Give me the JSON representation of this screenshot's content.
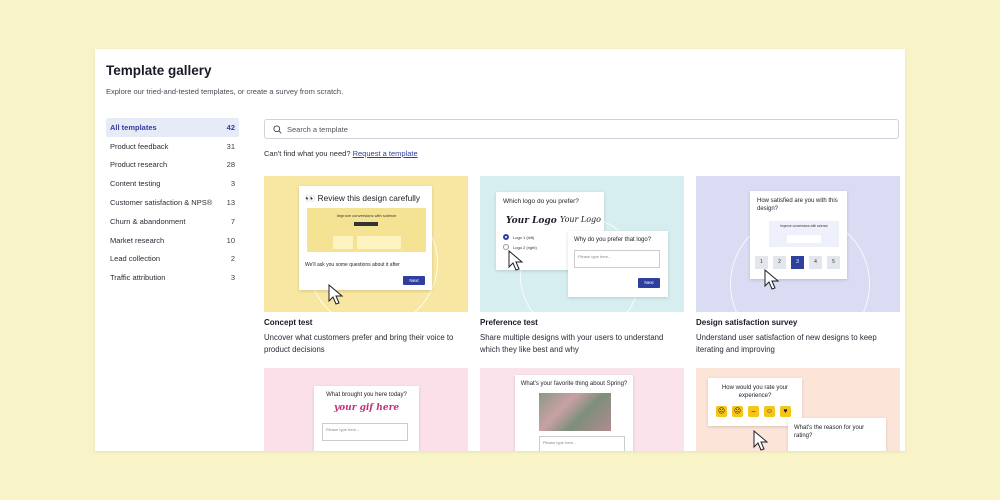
{
  "header": {
    "title": "Template gallery",
    "subtitle": "Explore our tried-and-tested templates, or create a survey from scratch."
  },
  "sidebar": {
    "items": [
      {
        "label": "All templates",
        "count": "42"
      },
      {
        "label": "Product feedback",
        "count": "31"
      },
      {
        "label": "Product research",
        "count": "28"
      },
      {
        "label": "Content testing",
        "count": "3"
      },
      {
        "label": "Customer satisfaction & NPS®",
        "count": "13"
      },
      {
        "label": "Churn & abandonment",
        "count": "7"
      },
      {
        "label": "Market research",
        "count": "10"
      },
      {
        "label": "Lead collection",
        "count": "2"
      },
      {
        "label": "Traffic attribution",
        "count": "3"
      }
    ]
  },
  "search": {
    "placeholder": "Search a template"
  },
  "request": {
    "prompt": "Can't find what you need?",
    "link": "Request a template"
  },
  "cards": [
    {
      "title": "Concept test",
      "desc": "Uncover what customers prefer and bring their voice to product decisions",
      "mock_heading": "Review this design carefully",
      "mock_inner": "Improve conversions with science",
      "mock_question": "We'll ask you some questions about it after",
      "button": "Next"
    },
    {
      "title": "Preference test",
      "desc": "Share multiple designs with your users to understand which they like best and why",
      "mock_question": "Which logo do you prefer?",
      "logo_a": "Your Logo",
      "logo_b": "Your Logo",
      "option_a": "Logo 1 (left)",
      "option_b": "Logo 2 (right)",
      "followup": "Why do you prefer that logo?",
      "placeholder": "Please type here...",
      "button": "Next"
    },
    {
      "title": "Design satisfaction survey",
      "desc": "Understand user satisfaction of new designs to keep iterating and improving",
      "mock_question": "How satisfied are you with this design?",
      "mock_inner": "Improve conversions with science",
      "scale": [
        "1",
        "2",
        "3",
        "4",
        "5"
      ],
      "selected": "3"
    },
    {
      "mock_question": "What brought you here today?",
      "gif_text": "your gif here",
      "placeholder": "Please type here..."
    },
    {
      "mock_question": "What's your favorite thing about Spring?",
      "placeholder": "Please type here..."
    },
    {
      "mock_question": "How would you rate your experience?",
      "followup": "What's the reason for your rating?"
    }
  ],
  "colors": {
    "background": "#f8f4c8",
    "accent": "#2f3f9e",
    "card1_bg": "#f8e7a2",
    "card2_bg": "#d6eef0",
    "card3_bg": "#d9dcf3",
    "card4_bg": "#fbe0ea",
    "card5_bg": "#fbe3ec",
    "card6_bg": "#fce4d8",
    "emoji": "#f5c518"
  }
}
